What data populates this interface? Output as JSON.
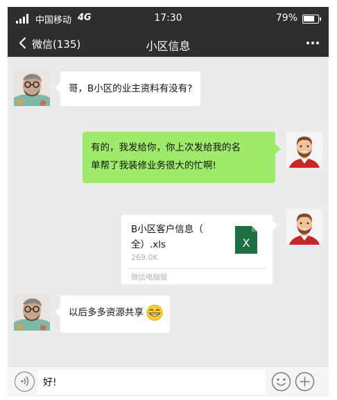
{
  "status_bar": {
    "carrier": "中国移动",
    "network": "4G",
    "time": "17:30",
    "battery": "79%",
    "battery_level": 0.79
  },
  "nav": {
    "back_label": "微信(135)",
    "title": "小区信息"
  },
  "messages": [
    {
      "side": "left",
      "type": "text",
      "text": "哥，B小区的业主资料有没有?"
    },
    {
      "side": "right",
      "type": "text",
      "lines": [
        "有的，我发给你，你上次发给我的名",
        "单帮了我装修业务很大的忙啊!"
      ]
    },
    {
      "side": "right",
      "type": "file",
      "file_name_lines": [
        "B小区客户信息（",
        "全）.xls"
      ],
      "file_size": "269.0K",
      "source": "微信电脑版",
      "file_icon_letter": "X"
    },
    {
      "side": "left",
      "type": "text",
      "text": "以后多多资源共享",
      "emoji": "grin-icon"
    }
  ],
  "input": {
    "value": "好!"
  },
  "colors": {
    "header_bg": "#2e2e30",
    "chat_bg": "#ebebeb",
    "sent_bubble": "#9eea6a",
    "received_bubble": "#ffffff",
    "excel_green": "#1d7044"
  }
}
